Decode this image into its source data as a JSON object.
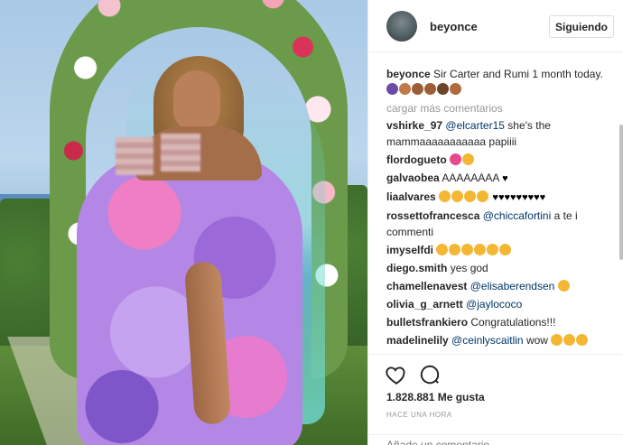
{
  "post": {
    "username": "beyonce",
    "follow_label": "Siguiendo"
  },
  "caption": {
    "username": "beyonce",
    "text": "Sir Carter and Rumi 1 month today."
  },
  "load_more_label": "cargar más comentarios",
  "comments": [
    {
      "user": "vshirke_97",
      "mention": "@elcarter15",
      "text": "she's the mammaaaaaaaaaaa papiiii"
    },
    {
      "user": "flordogueto",
      "mention": "",
      "text": ""
    },
    {
      "user": "galvaobea",
      "mention": "",
      "text": "AAAAAAAA"
    },
    {
      "user": "liaalvares",
      "mention": "",
      "text": ""
    },
    {
      "user": "rossettofrancesca",
      "mention": "@chiccafortini",
      "text": "a te i commenti"
    },
    {
      "user": "imyselfdi",
      "mention": "",
      "text": ""
    },
    {
      "user": "diego.smith",
      "mention": "",
      "text": "yes god"
    },
    {
      "user": "chamellenavest",
      "mention": "@elisaberendsen",
      "text": ""
    },
    {
      "user": "olivia_g_arnett",
      "mention": "@jaylococo",
      "text": ""
    },
    {
      "user": "bulletsfrankiero",
      "mention": "",
      "text": "Congratulations!!!"
    },
    {
      "user": "madelinelily",
      "mention": "@ceinlyscaitlin",
      "text": "wow"
    }
  ],
  "likes": "1.828.881 Me gusta",
  "time": "HACE UNA HORA",
  "add_comment_placeholder": "Añade un comentario...",
  "icons": {
    "like": "heart-outline-icon",
    "comment": "speech-bubble-icon"
  },
  "colors": {
    "mention": "#003569",
    "muted": "#999999",
    "border": "#efefef"
  }
}
